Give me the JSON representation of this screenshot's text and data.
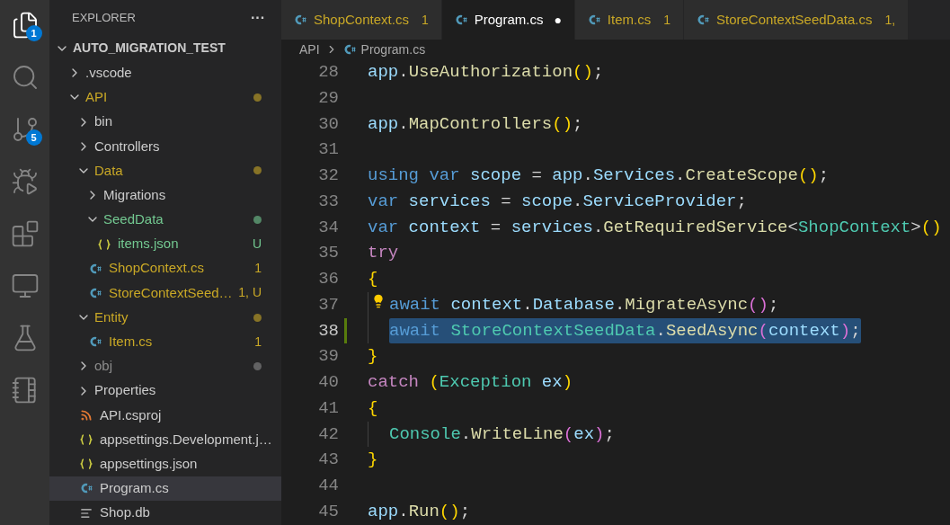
{
  "activity_bar": [
    {
      "kind": "files",
      "selected": true,
      "badge": "1"
    },
    {
      "kind": "search",
      "selected": false
    },
    {
      "kind": "source-control",
      "selected": false,
      "badge": "5"
    },
    {
      "kind": "run-debug",
      "selected": false
    },
    {
      "kind": "extensions",
      "selected": false
    },
    {
      "kind": "remote",
      "selected": false
    },
    {
      "kind": "testing",
      "selected": false
    },
    {
      "kind": "notebook",
      "selected": false
    }
  ],
  "explorer": {
    "title": "EXPLORER",
    "more": "···",
    "root": {
      "label": "AUTO_MIGRATION_TEST",
      "expanded": true,
      "children": [
        {
          "label": ".vscode",
          "kind": "folder",
          "expanded": false,
          "selected": false
        },
        {
          "label": "API",
          "kind": "folder",
          "expanded": true,
          "selected": false,
          "dot": true,
          "color": "#c9a826",
          "children": [
            {
              "label": "bin",
              "kind": "folder",
              "expanded": false,
              "selected": false
            },
            {
              "label": "Controllers",
              "kind": "folder",
              "expanded": false,
              "selected": false
            },
            {
              "label": "Data",
              "kind": "folder",
              "expanded": true,
              "selected": false,
              "dot": true,
              "color": "#c9a826",
              "children": [
                {
                  "label": "Migrations",
                  "kind": "folder",
                  "expanded": false,
                  "selected": false
                },
                {
                  "label": "SeedData",
                  "kind": "folder",
                  "expanded": true,
                  "selected": false,
                  "dot": true,
                  "color": "#73c991",
                  "children": [
                    {
                      "label": "items.json",
                      "kind": "json",
                      "selected": false,
                      "color": "#73c991",
                      "badge": "U"
                    }
                  ]
                },
                {
                  "label": "ShopContext.cs",
                  "kind": "csharp",
                  "selected": false,
                  "color": "#c9a826",
                  "badge": "1"
                },
                {
                  "label": "StoreContextSeed…",
                  "kind": "csharp",
                  "selected": false,
                  "color": "#c9a826",
                  "badge": "1, U"
                }
              ]
            },
            {
              "label": "Entity",
              "kind": "folder",
              "expanded": true,
              "selected": false,
              "dot": true,
              "color": "#c9a826",
              "children": [
                {
                  "label": "Item.cs",
                  "kind": "csharp",
                  "selected": false,
                  "color": "#c9a826",
                  "badge": "1"
                }
              ]
            },
            {
              "label": "obj",
              "kind": "folder",
              "expanded": false,
              "selected": false,
              "dot": true,
              "color": "#8c8c8c"
            },
            {
              "label": "Properties",
              "kind": "folder",
              "expanded": false,
              "selected": false
            },
            {
              "label": "API.csproj",
              "kind": "rss",
              "selected": false
            },
            {
              "label": "appsettings.Development.j…",
              "kind": "json",
              "selected": false
            },
            {
              "label": "appsettings.json",
              "kind": "json",
              "selected": false
            },
            {
              "label": "Program.cs",
              "kind": "csharp",
              "selected": true
            },
            {
              "label": "Shop.db",
              "kind": "text",
              "selected": false
            }
          ]
        }
      ]
    }
  },
  "tabs": [
    {
      "label": "ShopContext.cs",
      "badge": "1",
      "color": "#c9a826",
      "selected": false,
      "dirty": false
    },
    {
      "label": "Program.cs",
      "selected": true,
      "dirty": true,
      "dirty_mark": "●"
    },
    {
      "label": "Item.cs",
      "badge": "1",
      "color": "#c9a826",
      "selected": false,
      "dirty": false
    },
    {
      "label": "StoreContextSeedData.cs",
      "badge": "1,",
      "color": "#c9a826",
      "selected": false,
      "dirty": false
    }
  ],
  "breadcrumb": {
    "folder": "API",
    "file": "Program.cs"
  },
  "code": [
    {
      "number": "28",
      "indented": false,
      "selected": false,
      "modified": false,
      "lightbulb": false,
      "tokens": [
        {
          "text": "app",
          "kind": "var"
        },
        {
          "text": ".",
          "kind": "punc"
        },
        {
          "text": "UseAuthorization",
          "kind": "fn"
        },
        {
          "text": "()",
          "kind": "br1"
        },
        {
          "text": ";",
          "kind": "punc"
        }
      ]
    },
    {
      "number": "29",
      "indented": false,
      "selected": false,
      "modified": false,
      "lightbulb": false
    },
    {
      "number": "30",
      "indented": false,
      "selected": false,
      "modified": false,
      "lightbulb": false,
      "tokens": [
        {
          "text": "app",
          "kind": "var"
        },
        {
          "text": ".",
          "kind": "punc"
        },
        {
          "text": "MapControllers",
          "kind": "fn"
        },
        {
          "text": "()",
          "kind": "br1"
        },
        {
          "text": ";",
          "kind": "punc"
        }
      ]
    },
    {
      "number": "31",
      "indented": false,
      "selected": false,
      "modified": false,
      "lightbulb": false
    },
    {
      "number": "32",
      "indented": false,
      "selected": false,
      "modified": false,
      "lightbulb": false,
      "tokens": [
        {
          "text": "using var ",
          "kind": "kw"
        },
        {
          "text": "scope",
          "kind": "var"
        },
        {
          "text": " = ",
          "kind": "punc"
        },
        {
          "text": "app",
          "kind": "var"
        },
        {
          "text": ".",
          "kind": "punc"
        },
        {
          "text": "Services",
          "kind": "var"
        },
        {
          "text": ".",
          "kind": "punc"
        },
        {
          "text": "CreateScope",
          "kind": "fn"
        },
        {
          "text": "()",
          "kind": "br1"
        },
        {
          "text": ";",
          "kind": "punc"
        }
      ]
    },
    {
      "number": "33",
      "indented": false,
      "selected": false,
      "modified": false,
      "lightbulb": false,
      "tokens": [
        {
          "text": "var ",
          "kind": "kw"
        },
        {
          "text": "services",
          "kind": "var"
        },
        {
          "text": " = ",
          "kind": "punc"
        },
        {
          "text": "scope",
          "kind": "var"
        },
        {
          "text": ".",
          "kind": "punc"
        },
        {
          "text": "ServiceProvider",
          "kind": "var"
        },
        {
          "text": ";",
          "kind": "punc"
        }
      ]
    },
    {
      "number": "34",
      "indented": false,
      "selected": false,
      "modified": false,
      "lightbulb": false,
      "tokens": [
        {
          "text": "var ",
          "kind": "kw"
        },
        {
          "text": "context",
          "kind": "var"
        },
        {
          "text": " = ",
          "kind": "punc"
        },
        {
          "text": "services",
          "kind": "var"
        },
        {
          "text": ".",
          "kind": "punc"
        },
        {
          "text": "GetRequiredService",
          "kind": "fn"
        },
        {
          "text": "<",
          "kind": "punc"
        },
        {
          "text": "ShopContext",
          "kind": "type"
        },
        {
          "text": ">",
          "kind": "punc"
        },
        {
          "text": "()",
          "kind": "br1"
        }
      ]
    },
    {
      "number": "35",
      "indented": false,
      "selected": false,
      "modified": false,
      "lightbulb": false,
      "tokens": [
        {
          "text": "try",
          "kind": "ctl"
        }
      ]
    },
    {
      "number": "36",
      "indented": false,
      "selected": false,
      "modified": false,
      "lightbulb": false,
      "tokens": [
        {
          "text": "{",
          "kind": "br1"
        }
      ]
    },
    {
      "number": "37",
      "indented": true,
      "selected": false,
      "modified": false,
      "lightbulb": true,
      "tokens": [
        {
          "text": "await ",
          "kind": "kw"
        },
        {
          "text": "context",
          "kind": "var"
        },
        {
          "text": ".",
          "kind": "punc"
        },
        {
          "text": "Database",
          "kind": "var"
        },
        {
          "text": ".",
          "kind": "punc"
        },
        {
          "text": "MigrateAsync",
          "kind": "fn"
        },
        {
          "text": "()",
          "kind": "br2"
        },
        {
          "text": ";",
          "kind": "punc"
        }
      ]
    },
    {
      "number": "38",
      "indented": true,
      "selected": true,
      "modified": true,
      "lightbulb": false,
      "tokens": [
        {
          "text": "await ",
          "kind": "kw"
        },
        {
          "text": "StoreContextSeedData",
          "kind": "type"
        },
        {
          "text": ".",
          "kind": "punc"
        },
        {
          "text": "SeedAsync",
          "kind": "fn"
        },
        {
          "text": "(",
          "kind": "br2"
        },
        {
          "text": "context",
          "kind": "var"
        },
        {
          "text": ")",
          "kind": "br2"
        },
        {
          "text": ";",
          "kind": "punc"
        }
      ]
    },
    {
      "number": "39",
      "indented": false,
      "selected": false,
      "modified": false,
      "lightbulb": false,
      "tokens": [
        {
          "text": "}",
          "kind": "br1"
        }
      ]
    },
    {
      "number": "40",
      "indented": false,
      "selected": false,
      "modified": false,
      "lightbulb": false,
      "tokens": [
        {
          "text": "catch ",
          "kind": "ctl"
        },
        {
          "text": "(",
          "kind": "br1"
        },
        {
          "text": "Exception",
          "kind": "type"
        },
        {
          "text": " ex",
          "kind": "var"
        },
        {
          "text": ")",
          "kind": "br1"
        }
      ]
    },
    {
      "number": "41",
      "indented": false,
      "selected": false,
      "modified": false,
      "lightbulb": false,
      "tokens": [
        {
          "text": "{",
          "kind": "br1"
        }
      ]
    },
    {
      "number": "42",
      "indented": true,
      "selected": false,
      "modified": false,
      "lightbulb": false,
      "tokens": [
        {
          "text": "Console",
          "kind": "type"
        },
        {
          "text": ".",
          "kind": "punc"
        },
        {
          "text": "WriteLine",
          "kind": "fn"
        },
        {
          "text": "(",
          "kind": "br2"
        },
        {
          "text": "ex",
          "kind": "var"
        },
        {
          "text": ")",
          "kind": "br2"
        },
        {
          "text": ";",
          "kind": "punc"
        }
      ]
    },
    {
      "number": "43",
      "indented": false,
      "selected": false,
      "modified": false,
      "lightbulb": false,
      "tokens": [
        {
          "text": "}",
          "kind": "br1"
        }
      ]
    },
    {
      "number": "44",
      "indented": false,
      "selected": false,
      "modified": false,
      "lightbulb": false
    },
    {
      "number": "45",
      "indented": false,
      "selected": false,
      "modified": false,
      "lightbulb": false,
      "tokens": [
        {
          "text": "app",
          "kind": "var"
        },
        {
          "text": ".",
          "kind": "punc"
        },
        {
          "text": "Run",
          "kind": "fn"
        },
        {
          "text": "()",
          "kind": "br1"
        },
        {
          "text": ";",
          "kind": "punc"
        }
      ]
    }
  ]
}
